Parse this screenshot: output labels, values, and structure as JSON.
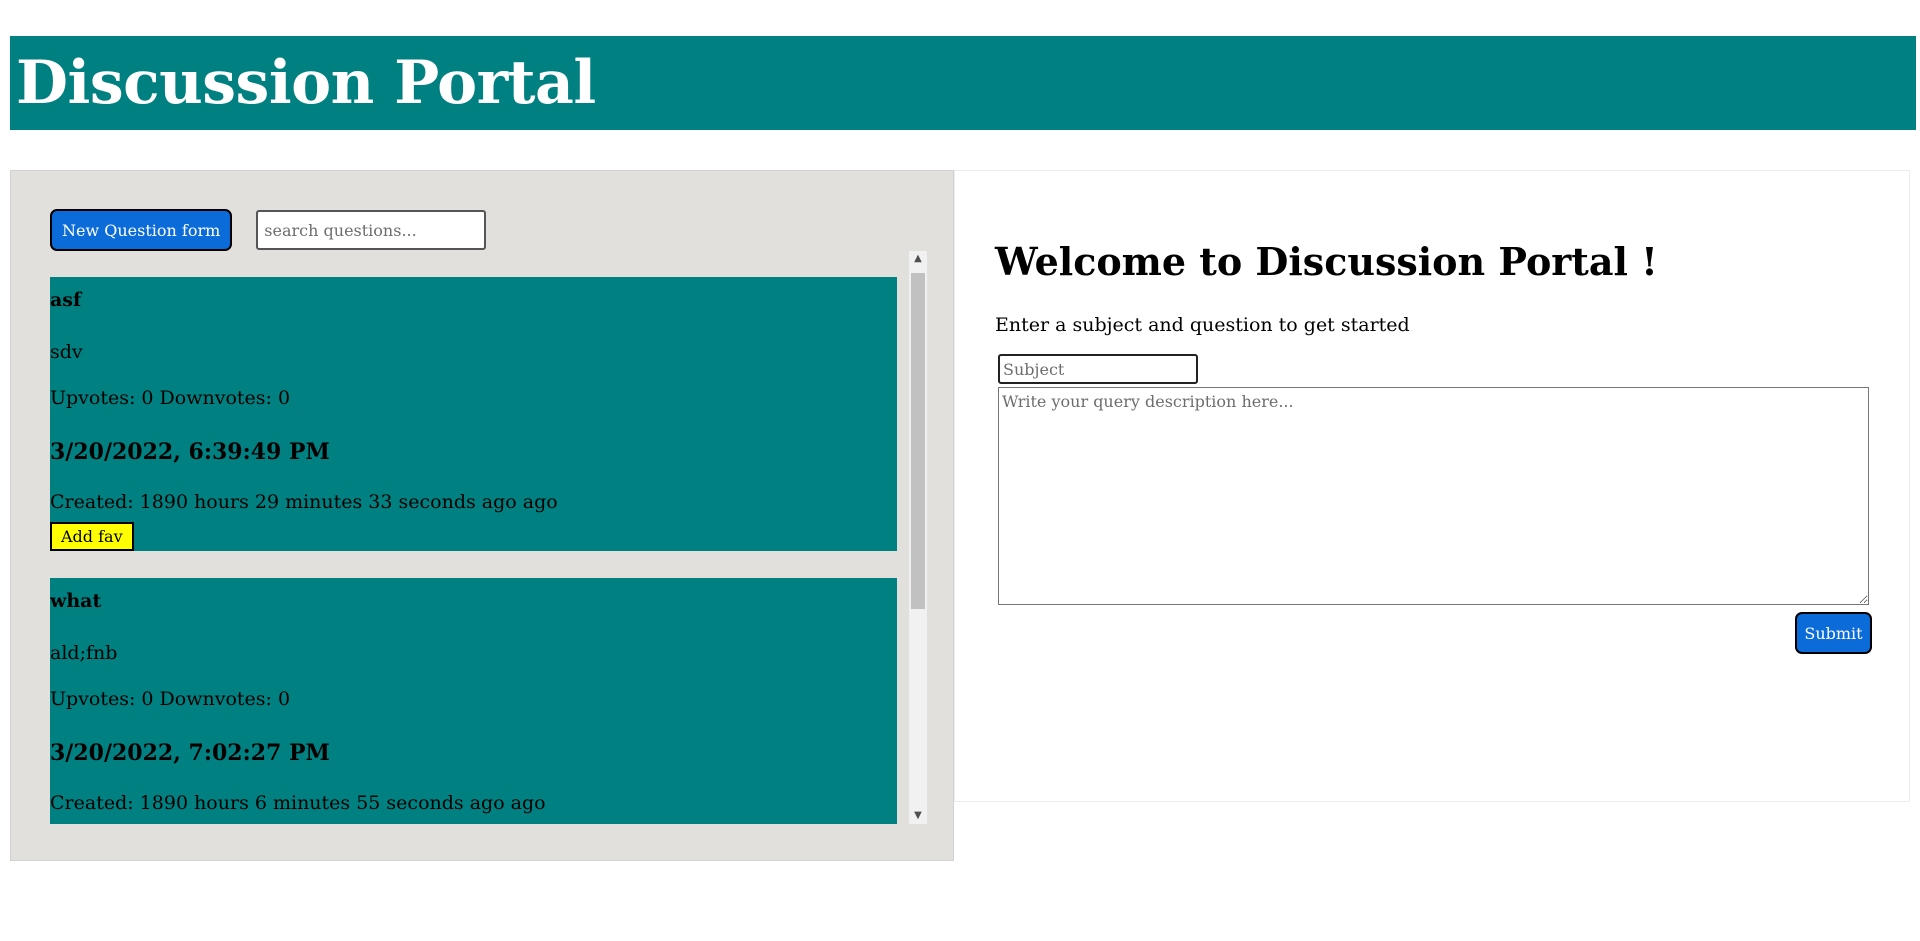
{
  "header": {
    "title": "Discussion Portal"
  },
  "left": {
    "new_question_label": "New Question form",
    "search_placeholder": "search questions...",
    "questions": [
      {
        "subject": "asf",
        "description": "sdv",
        "votes": "Upvotes: 0 Downvotes: 0",
        "date": "3/20/2022, 6:39:49 PM",
        "created": "Created: 1890 hours 29 minutes 33 seconds ago ago",
        "fav_label": "Add fav"
      },
      {
        "subject": "what",
        "description": "ald;fnb",
        "votes": "Upvotes: 0 Downvotes: 0",
        "date": "3/20/2022, 7:02:27 PM",
        "created": "Created: 1890 hours 6 minutes 55 seconds ago ago"
      }
    ]
  },
  "right": {
    "welcome_title": "Welcome to Discussion Portal !",
    "intro": "Enter a subject and question to get started",
    "subject_placeholder": "Subject",
    "description_placeholder": "Write your query description here...",
    "submit_label": "Submit"
  },
  "colors": {
    "header_bg": "#008080",
    "card_bg": "#008080",
    "panel_bg": "#e2e0dd",
    "button_blue": "#0b6bd8",
    "fav_yellow": "#ffff00"
  },
  "icons": {
    "scroll_up": "triangle-up-icon",
    "scroll_down": "triangle-down-icon"
  }
}
